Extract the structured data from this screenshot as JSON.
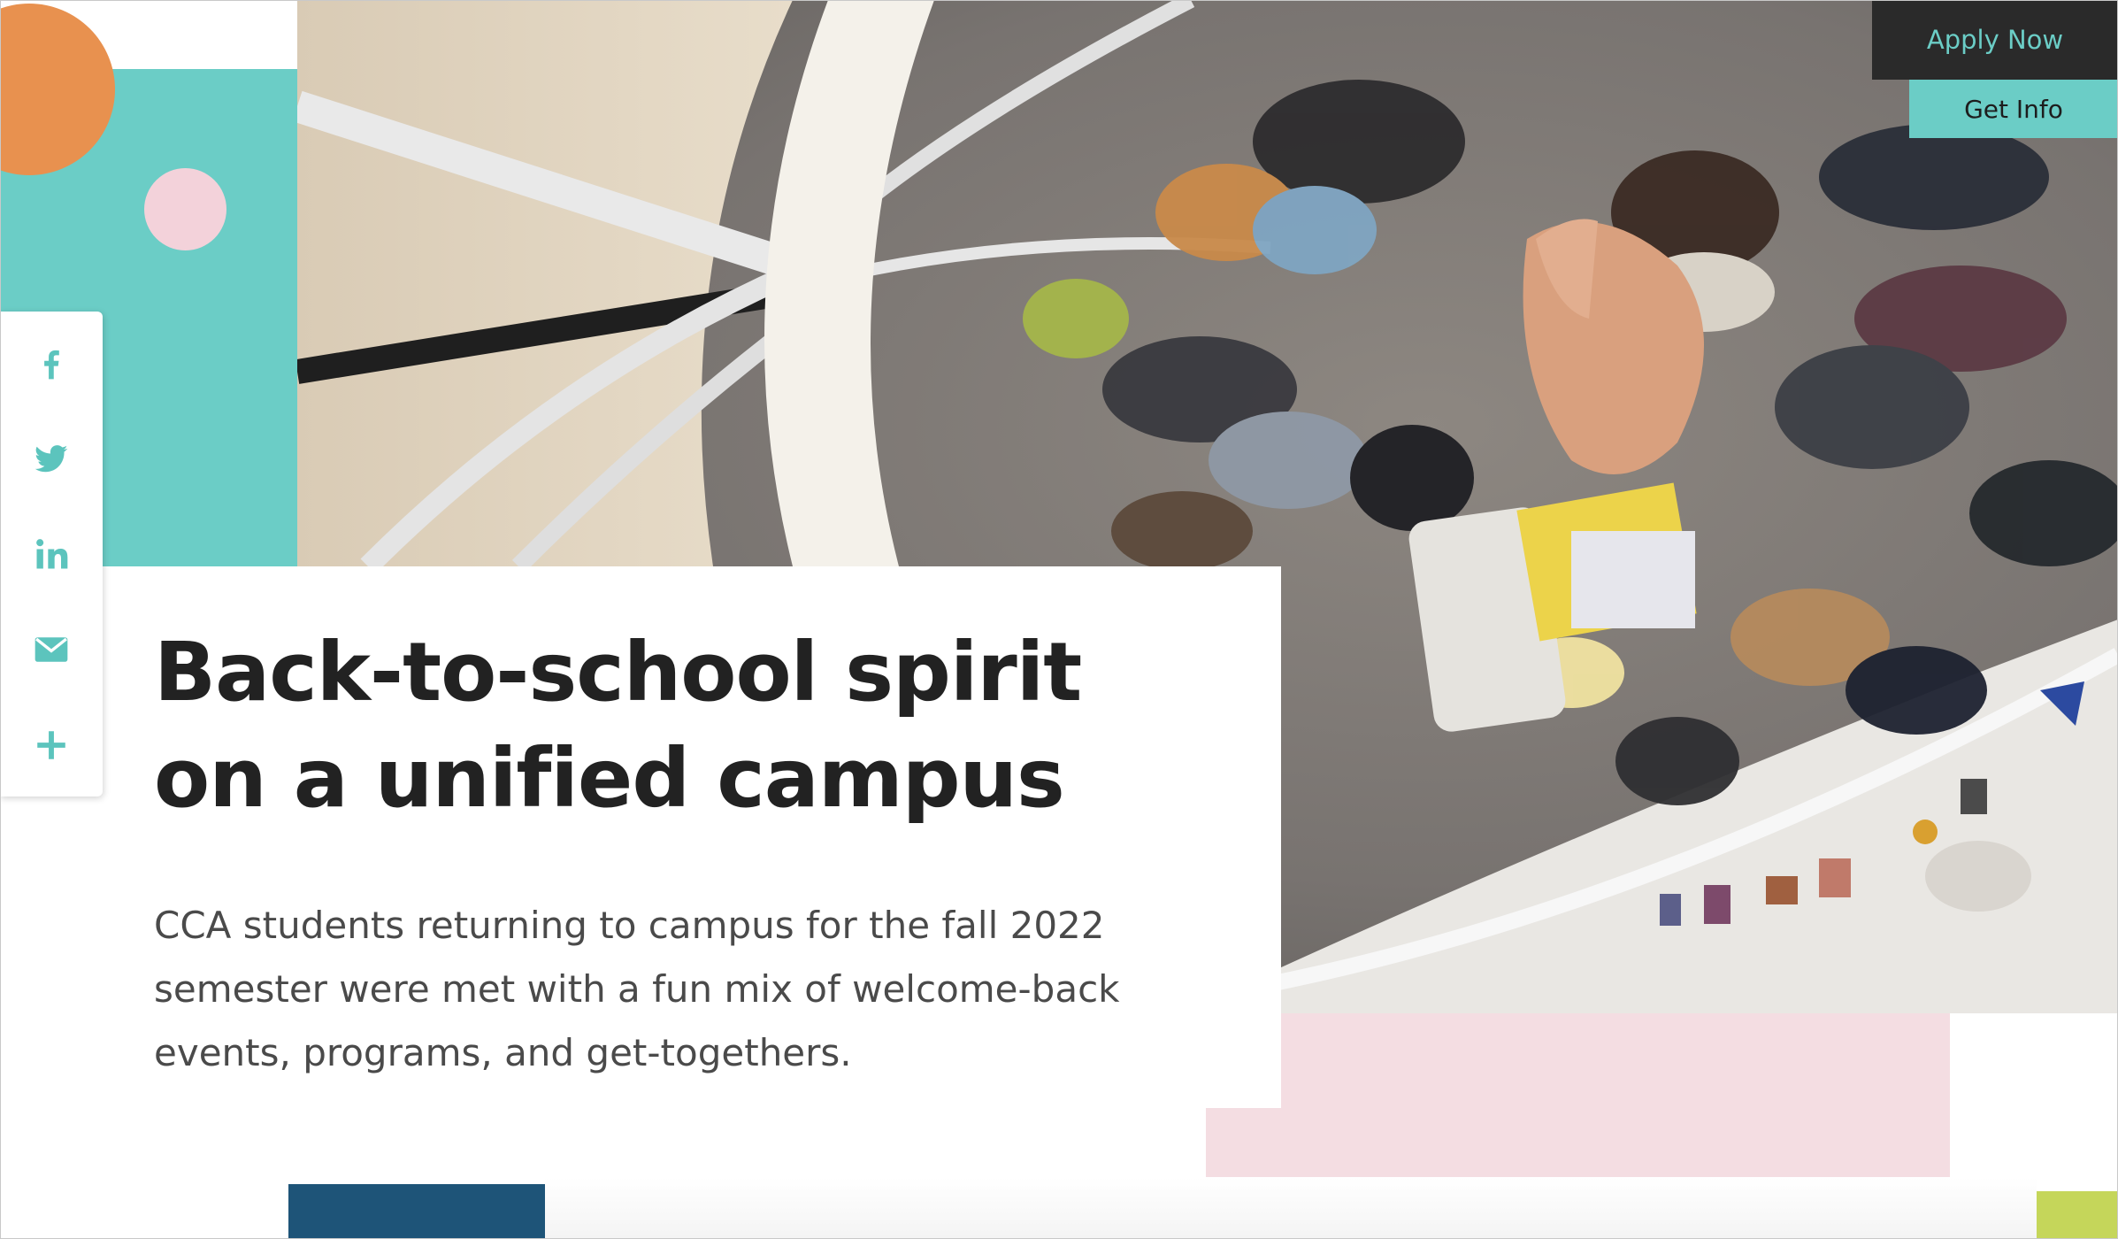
{
  "hero": {
    "image_description": "",
    "headline": "Back-to-school spirit on a unified campus",
    "lede": "CCA students returning to campus for the fall 2022 semester were met with a fun mix of welcome-back events, programs, and get-togethers."
  },
  "cta": {
    "apply_label": "Apply Now",
    "info_label": "Get Info"
  },
  "share": {
    "items": [
      {
        "icon": "facebook-icon"
      },
      {
        "icon": "twitter-icon"
      },
      {
        "icon": "linkedin-icon"
      },
      {
        "icon": "email-icon"
      },
      {
        "icon": "plus-icon"
      }
    ]
  },
  "colors": {
    "teal": "#6bcdc6",
    "orange": "#e8914f",
    "pink": "#f3d2da",
    "navy": "#1e5478",
    "lime": "#c5d65a",
    "text_dark": "#222222",
    "text_body": "#4a4a4a"
  }
}
